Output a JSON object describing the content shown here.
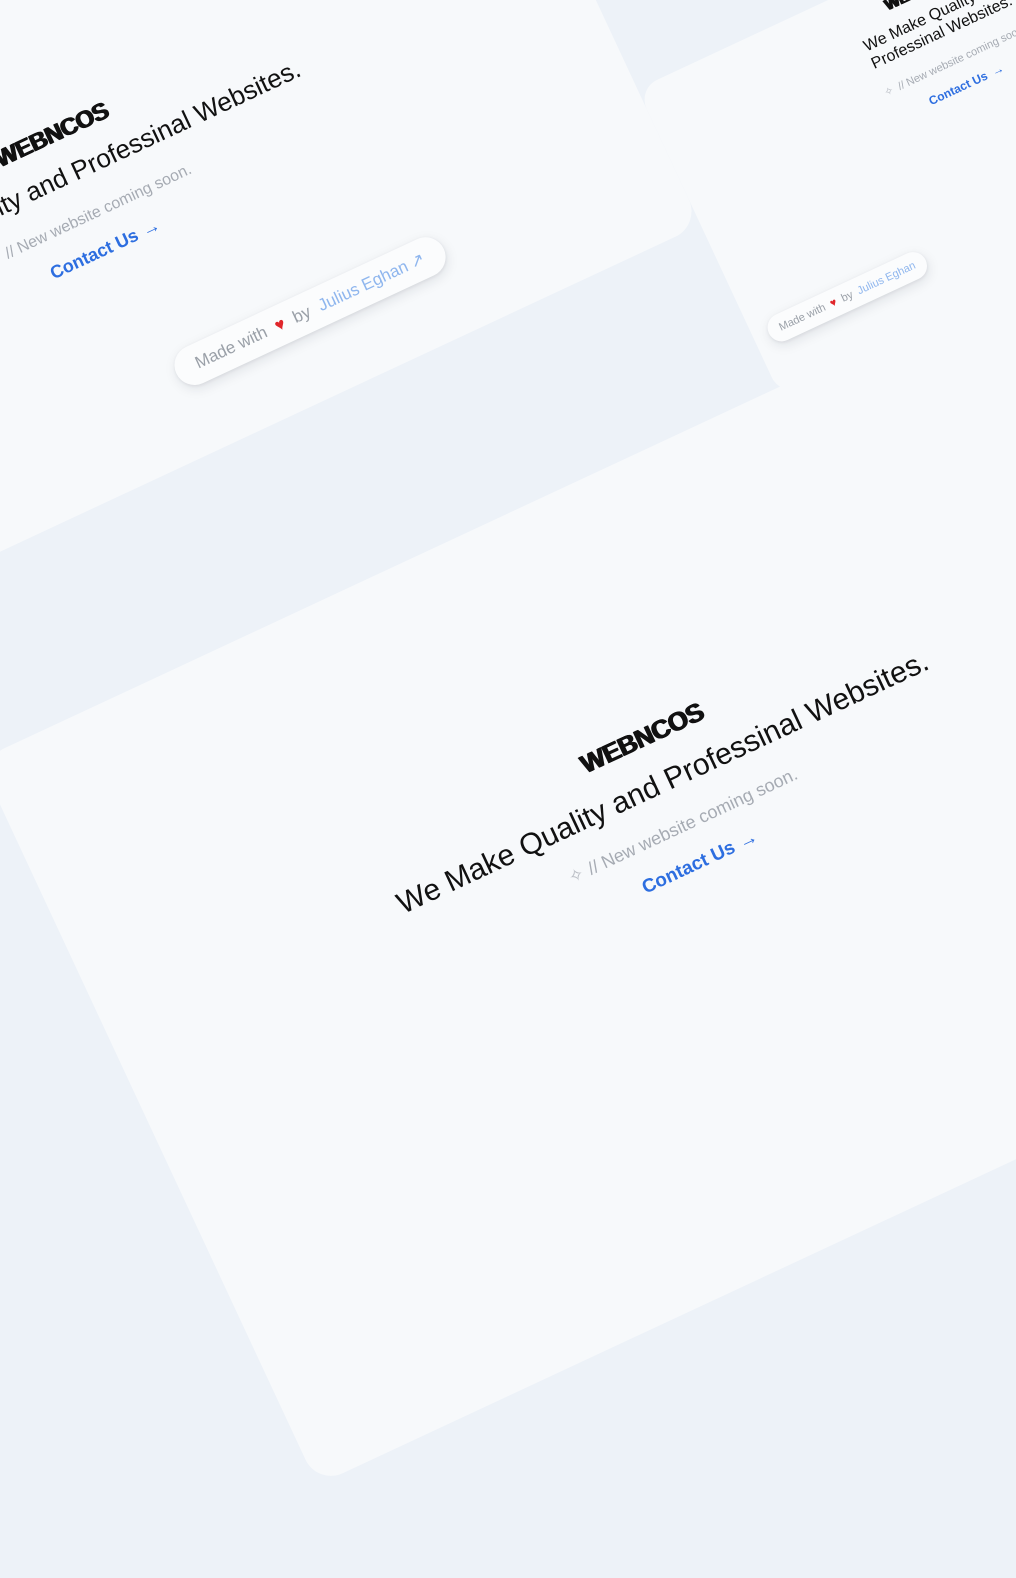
{
  "brand": {
    "logo_text": "WEBNCOS"
  },
  "hero": {
    "headline_line1": "We Make Quality and Professinal Websites.",
    "headline_two_line_a": "We Make Quality and",
    "headline_two_line_b": "Professinal Websites.",
    "headline_partial": "ality and Professinal Websites.",
    "tagline": "// New website coming soon.",
    "sparkle_icon": "sparkle-icon",
    "contact_label": "Contact Us",
    "contact_arrow": "→"
  },
  "footer": {
    "made_with": "Made with",
    "heart": "♥",
    "by": "by",
    "author": "Julius Eghan",
    "external_arrow": "↗"
  },
  "colors": {
    "background": "#edf2f8",
    "card": "#f7f9fb",
    "accent": "#2d6ee0",
    "link_light": "#8fb6ee",
    "heart": "#e0262b"
  }
}
